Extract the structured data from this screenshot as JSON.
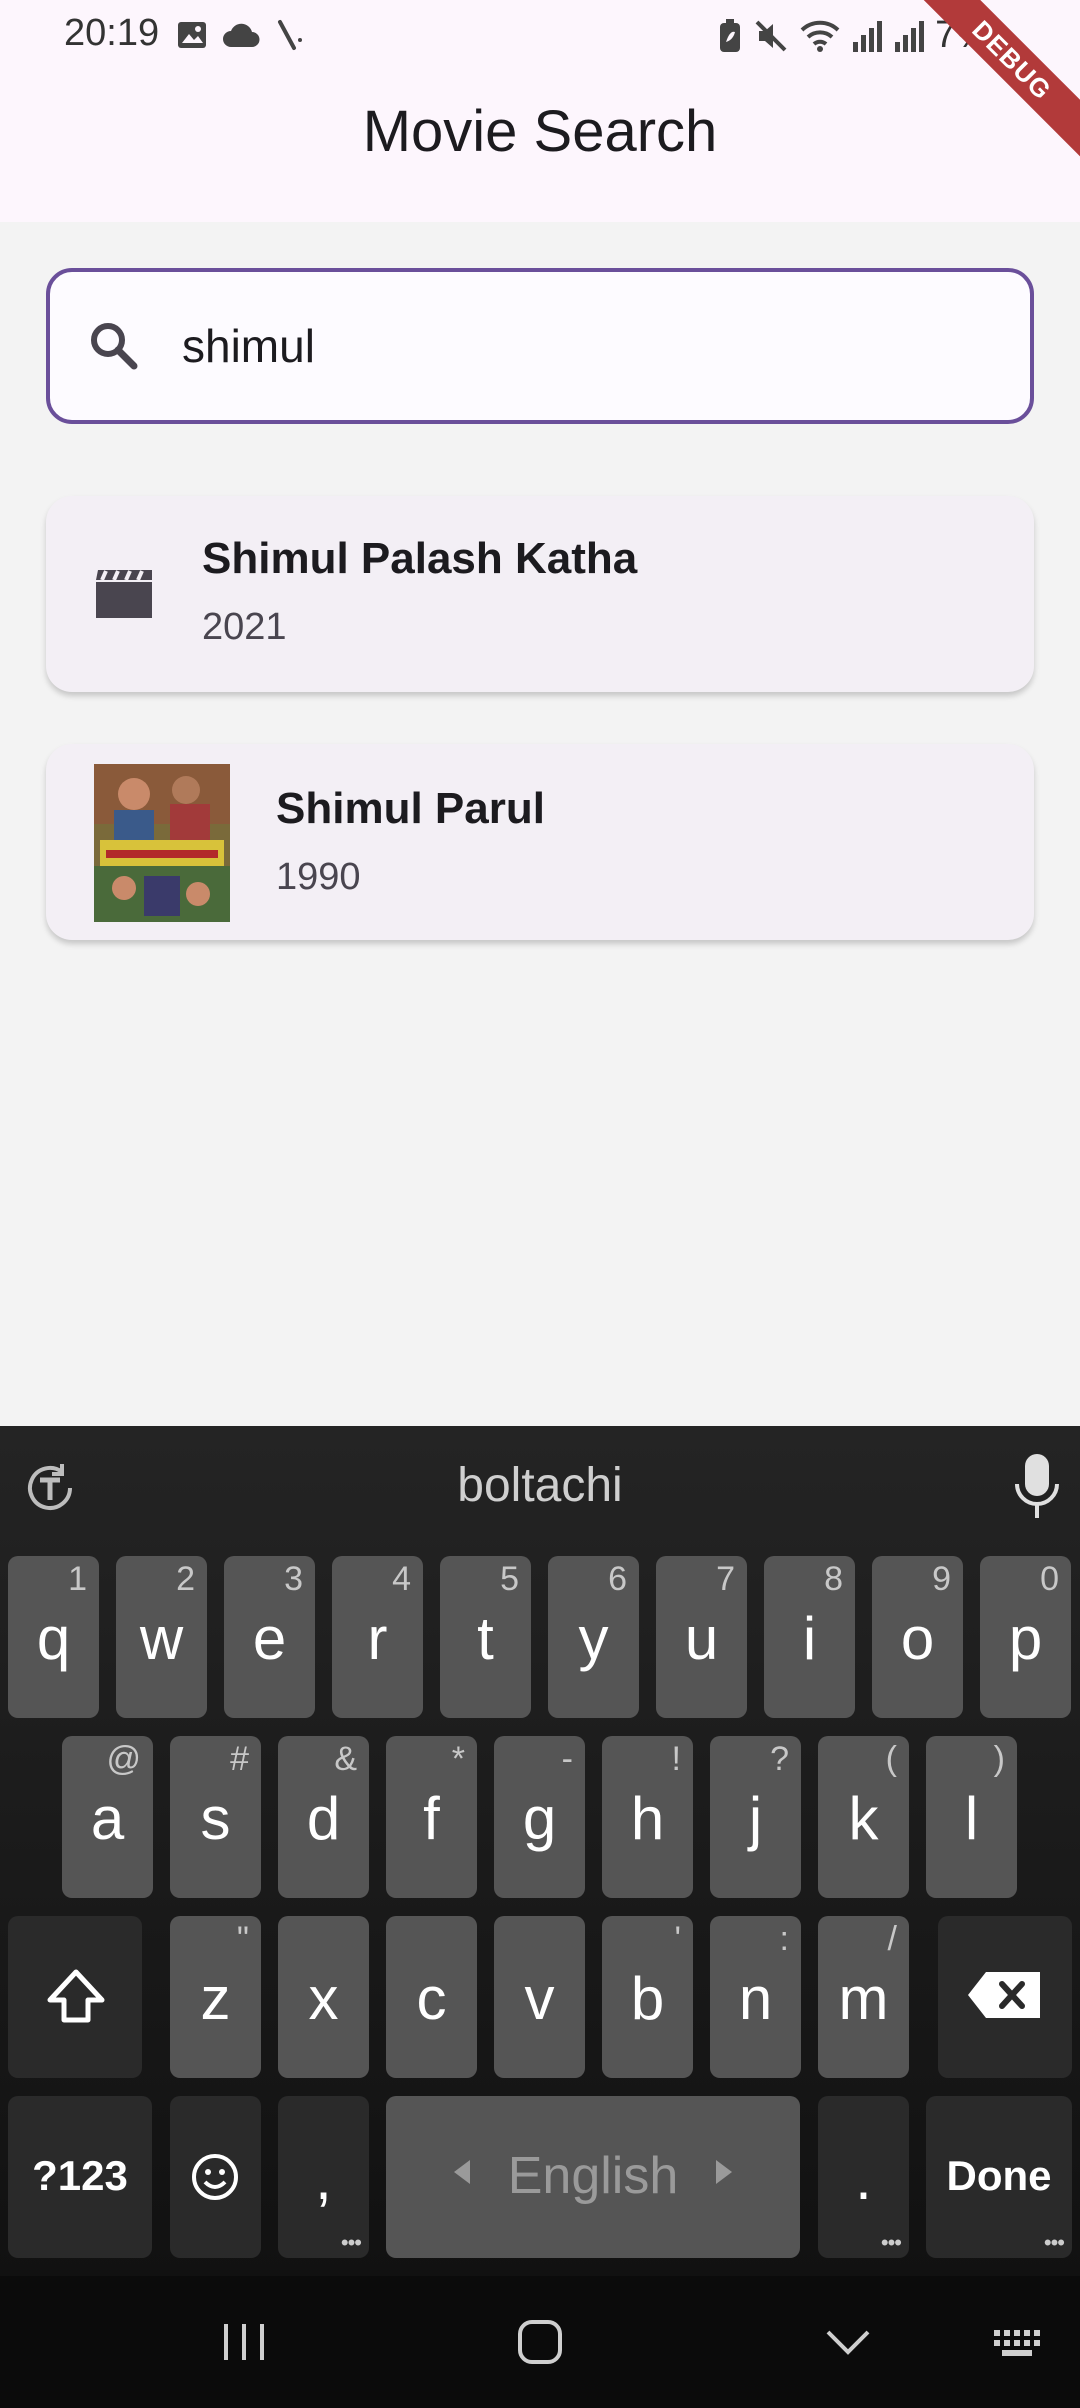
{
  "status_bar": {
    "time": "20:19",
    "battery": "7%"
  },
  "debug_banner": "DEBUG",
  "app_bar": {
    "title": "Movie Search"
  },
  "search": {
    "value": "shimul",
    "placeholder": ""
  },
  "results": [
    {
      "title": "Shimul Palash Katha",
      "year": "2021",
      "thumbnail": "clapperboard-icon"
    },
    {
      "title": "Shimul Parul",
      "year": "1990",
      "thumbnail": "movie-poster"
    }
  ],
  "keyboard": {
    "suggestion": "boltachi",
    "row1": [
      {
        "key": "q",
        "hint": "1"
      },
      {
        "key": "w",
        "hint": "2"
      },
      {
        "key": "e",
        "hint": "3"
      },
      {
        "key": "r",
        "hint": "4"
      },
      {
        "key": "t",
        "hint": "5"
      },
      {
        "key": "y",
        "hint": "6"
      },
      {
        "key": "u",
        "hint": "7"
      },
      {
        "key": "i",
        "hint": "8"
      },
      {
        "key": "o",
        "hint": "9"
      },
      {
        "key": "p",
        "hint": "0"
      }
    ],
    "row2": [
      {
        "key": "a",
        "hint": "@"
      },
      {
        "key": "s",
        "hint": "#"
      },
      {
        "key": "d",
        "hint": "&"
      },
      {
        "key": "f",
        "hint": "*"
      },
      {
        "key": "g",
        "hint": "-"
      },
      {
        "key": "h",
        "hint": "!"
      },
      {
        "key": "j",
        "hint": "?"
      },
      {
        "key": "k",
        "hint": "("
      },
      {
        "key": "l",
        "hint": ")"
      }
    ],
    "row3": [
      {
        "key": "z",
        "hint": "\""
      },
      {
        "key": "x",
        "hint": ""
      },
      {
        "key": "c",
        "hint": ""
      },
      {
        "key": "v",
        "hint": ""
      },
      {
        "key": "b",
        "hint": "'"
      },
      {
        "key": "n",
        "hint": ":"
      },
      {
        "key": "m",
        "hint": "/"
      }
    ],
    "symbols_label": "?123",
    "comma": ",",
    "space_label": "English",
    "period": ".",
    "done_label": "Done"
  },
  "colors": {
    "accent": "#6a4f9a",
    "app_bar_bg": "#fdf6fd",
    "card_bg": "#f3eff5",
    "debug_ribbon": "#b23a3a"
  }
}
